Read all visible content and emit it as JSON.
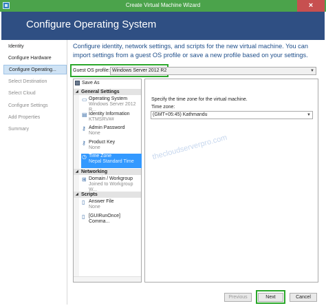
{
  "window": {
    "title": "Create Virtual Machine Wizard",
    "close_label": "×"
  },
  "header": {
    "title": "Configure Operating System"
  },
  "steps": [
    {
      "label": "Identity",
      "state": "done"
    },
    {
      "label": "Configure Hardware",
      "state": "done"
    },
    {
      "label": "Configure Operating...",
      "state": "active"
    },
    {
      "label": "Select Destination",
      "state": "pending"
    },
    {
      "label": "Select Cloud",
      "state": "pending"
    },
    {
      "label": "Configure Settings",
      "state": "pending"
    },
    {
      "label": "Add Properties",
      "state": "pending"
    },
    {
      "label": "Summary",
      "state": "pending"
    }
  ],
  "main": {
    "instructions": "Configure identity, network settings, and scripts for the new virtual machine. You can import settings from a guest OS profile or save a new profile based on your settings.",
    "guest_os_label": "Guest OS profile:",
    "guest_os_value": "Windows Server 2012 R2",
    "save_as_label": "Save As",
    "tree": {
      "sections": [
        {
          "label": "General Settings"
        },
        {
          "label": "Networking"
        },
        {
          "label": "Scripts"
        }
      ],
      "nodes": [
        {
          "label": "Operating System",
          "sub": "Windows Server 2012 R...",
          "icon": "monitor-icon"
        },
        {
          "label": "Identity Information",
          "sub": "KTMSRV##",
          "icon": "id-card-icon"
        },
        {
          "label": "Admin Password",
          "sub": "None",
          "icon": "key-icon"
        },
        {
          "label": "Product Key",
          "sub": "None",
          "icon": "key-icon"
        },
        {
          "label": "Time Zone",
          "sub": "Nepal Standard Time",
          "icon": "clock-icon"
        },
        {
          "label": "Domain / Workgroup",
          "sub": "Joined to Workgroup W...",
          "icon": "network-icon"
        },
        {
          "label": "Answer File",
          "sub": "None",
          "icon": "file-icon"
        },
        {
          "label": "[GUIRunOnce] Comma...",
          "sub": "",
          "icon": "script-icon"
        }
      ]
    },
    "detail": {
      "description": "Specify the time zone for the virtual machine.",
      "time_zone_label": "Time zone:",
      "time_zone_value": "(GMT+05:45) Kathmandu"
    },
    "watermark": "thecloudserverpro.com"
  },
  "footer": {
    "previous_label": "Previous",
    "next_label": "Next",
    "cancel_label": "Cancel"
  },
  "colors": {
    "titlebar": "#4ba34b",
    "header": "#2f4f83",
    "highlight": "#2aa72a",
    "selected": "#3399ff"
  }
}
